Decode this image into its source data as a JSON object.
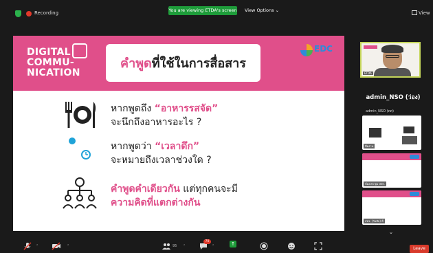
{
  "top_bar": {
    "recording_label": "Recording",
    "viewing_banner": "You are viewing ETDA's screen",
    "view_options": "View Options ⌄",
    "view_label": "View"
  },
  "slide": {
    "brand_lines": [
      "DIGITAL",
      "COMMU-",
      "NICATION"
    ],
    "title_highlight": "คำพูด",
    "title_rest": "ที่ใช้ในการสื่อสาร",
    "logo_text": "EDC",
    "rows": [
      {
        "icon": "fork-plate-knife-icon",
        "line1_prefix": "หากพูดถึง ",
        "line1_highlight": "“อาหารรสจัด”",
        "line2": "จะนึกถึงอาหารอะไร ?"
      },
      {
        "icon": "clock-moon-icon",
        "line1_prefix": "หากพูดว่า ",
        "line1_highlight": "“เวลาดึก”",
        "line2": "จะหมายถึงเวลาช่วงใด ?"
      },
      {
        "icon": "network-people-icon",
        "line1_highlight": "คำพูดคำเดียวกัน",
        "line1_suffix": " แต่ทุกคนจะมี",
        "line2_highlight": "ความคิดที่แตกต่างกัน"
      }
    ]
  },
  "sidebar": {
    "self_name": "ETDA",
    "admin_name": "admin_NSO (ว่อง)",
    "admin_thumb_label": "admin_NSO (ทศ)",
    "thumbnails": [
      {
        "name": "ทีมงาน"
      },
      {
        "name": "ห้องประชุม สพร."
      },
      {
        "name": "สพร. (วันชัย) ดี"
      }
    ]
  },
  "bottom_bar": {
    "participants_count": "95",
    "chat_badge": "70",
    "leave_label": "Leave"
  },
  "colors": {
    "accent_pink": "#e04f8a",
    "recording_red": "#e0392b",
    "banner_green": "#1e9c3a",
    "self_border": "#c5d65a"
  }
}
